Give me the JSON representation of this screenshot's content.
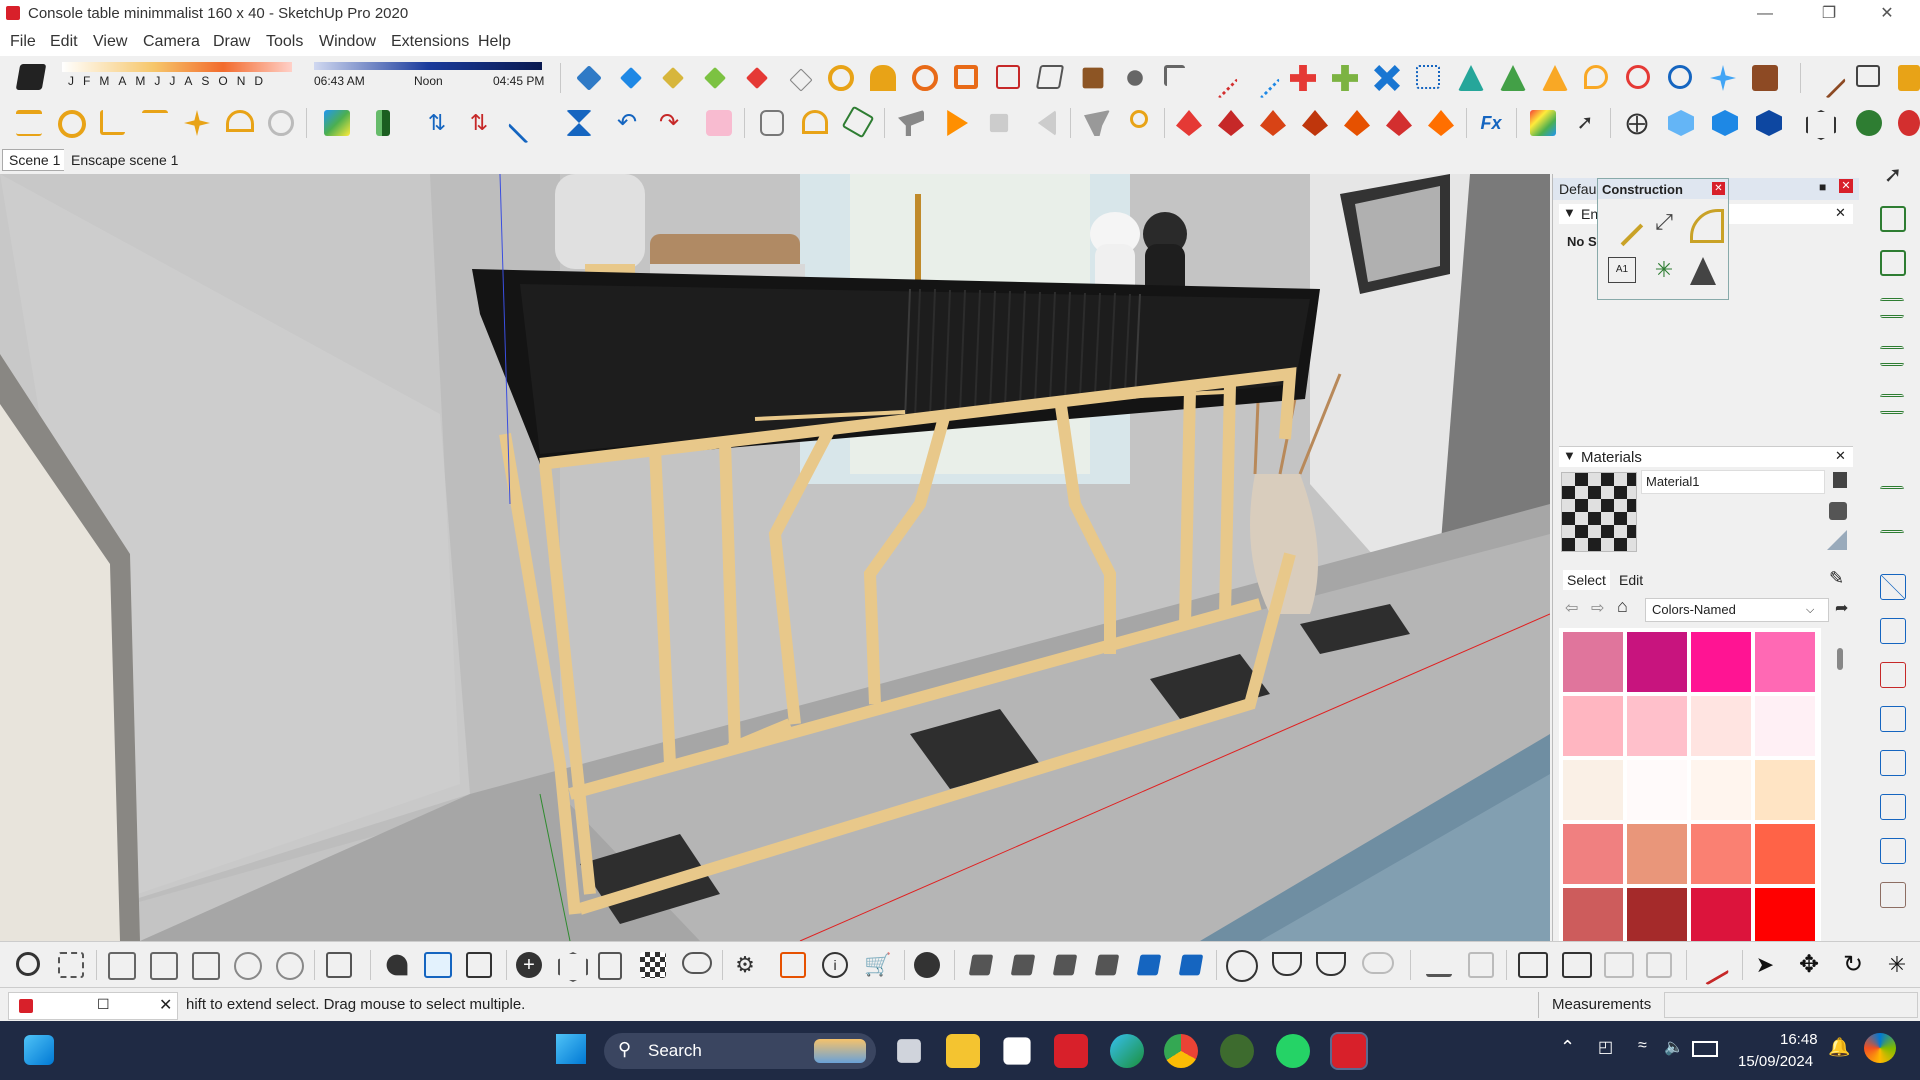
{
  "window": {
    "title": "Console table minimmalist 160 x 40 - SketchUp Pro 2020"
  },
  "menu": [
    "File",
    "Edit",
    "View",
    "Camera",
    "Draw",
    "Tools",
    "Window",
    "Extensions",
    "Help"
  ],
  "shadow": {
    "months": [
      "J",
      "F",
      "M",
      "A",
      "M",
      "J",
      "J",
      "A",
      "S",
      "O",
      "N",
      "D"
    ],
    "time_start": "06:43 AM",
    "time_mid": "Noon",
    "time_end": "04:45 PM"
  },
  "scenes": {
    "tabs": [
      "Scene 1",
      "Enscape scene 1"
    ]
  },
  "tray": {
    "default_tray_label": "Defau",
    "entity_label": "En",
    "no_selection": "No S",
    "construction": {
      "title": "Construction",
      "close_icon": "close-icon"
    },
    "materials": {
      "title": "Materials",
      "material_name": "Material1",
      "tabs": [
        "Select",
        "Edit"
      ],
      "library": "Colors-Named",
      "swatch_colors": [
        "#e0759c",
        "#c8147e",
        "#ff1493",
        "#ff69b4",
        "#ffb6c1",
        "#ffc0cb",
        "#ffe4e1",
        "#fff0f5",
        "#faf0e6",
        "#fffafa",
        "#fff5ee",
        "#ffe4c4",
        "#f08080",
        "#e9967a",
        "#fa8072",
        "#ff6347",
        "#cd5c5c",
        "#a52a2a",
        "#dc143c",
        "#ff0000"
      ]
    }
  },
  "status": {
    "hint": "hift to extend select. Drag mouse to select multiple.",
    "measurements_label": "Measurements",
    "measurements_value": ""
  },
  "taskbar": {
    "search_placeholder": "Search",
    "time": "16:48",
    "date": "15/09/2024",
    "apps": [
      "file-explorer-icon",
      "store-icon",
      "sketchup-icon",
      "edge-icon",
      "chrome-icon",
      "app-icon",
      "whatsapp-icon",
      "sketchup-active-icon"
    ]
  },
  "colors": {
    "accent": "#d8202a",
    "gold_frame": "#e8c88a",
    "table_top": "#1a1a1a",
    "taskbar": "#1f2a44"
  }
}
